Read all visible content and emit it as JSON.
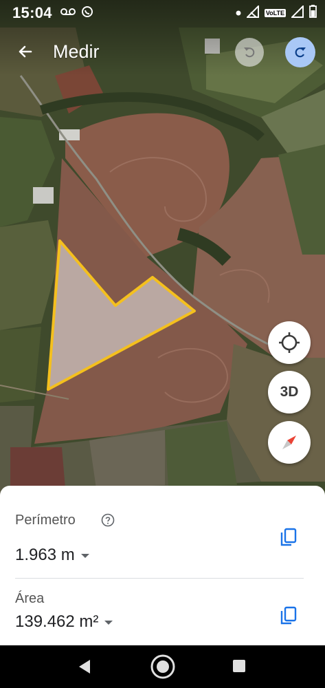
{
  "status_bar": {
    "time": "15:04",
    "volte_label": "VoLTE",
    "icons": [
      "voicemail-icon",
      "whatsapp-icon",
      "notification-dot-icon",
      "signal-icon",
      "signal-icon",
      "battery-icon"
    ]
  },
  "app_bar": {
    "title": "Medir",
    "back_icon": "arrow-back-icon",
    "undo_icon": "undo-icon",
    "redo_icon": "redo-icon"
  },
  "map": {
    "polygon_color": "#f4c01e",
    "controls": {
      "location_icon": "my-location-icon",
      "view3d_label": "3D",
      "compass_icon": "compass-icon"
    }
  },
  "measurement": {
    "perimeter": {
      "label": "Perímetro",
      "value": "1.963 m",
      "help_icon": "help-circle-icon",
      "copy_icon": "copy-icon"
    },
    "area": {
      "label": "Área",
      "value": "139.462 m²",
      "copy_icon": "copy-icon"
    }
  },
  "nav_bar": {
    "icons": [
      "nav-back-icon",
      "nav-home-icon",
      "nav-recents-icon"
    ]
  },
  "colors": {
    "accent_blue": "#1a73e8",
    "redo_bg": "#a9c8f6",
    "compass_red": "#ea4335"
  }
}
